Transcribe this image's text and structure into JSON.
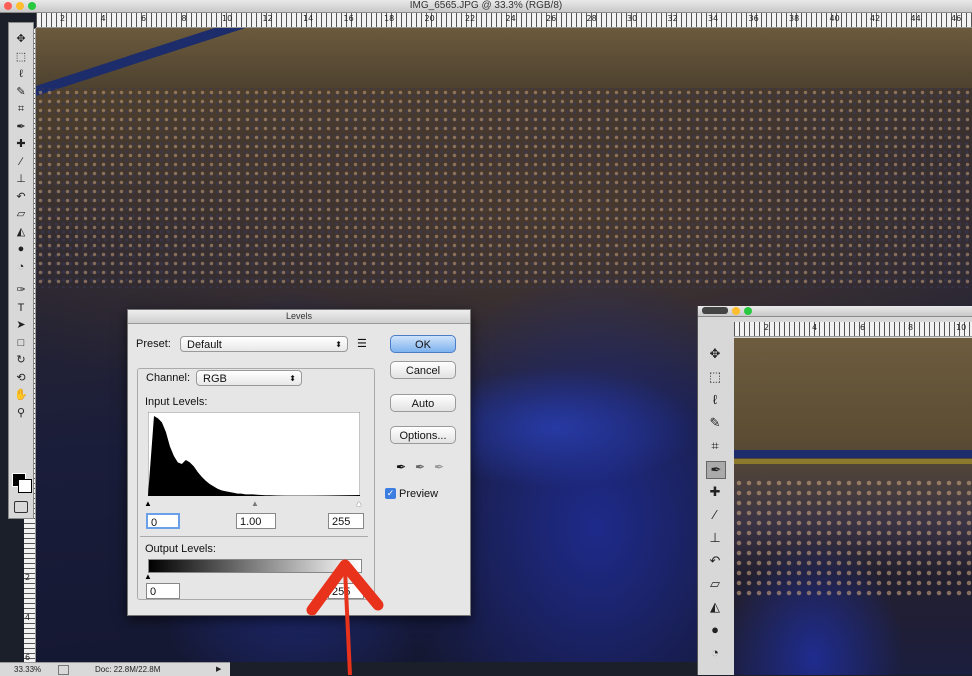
{
  "window": {
    "title": "IMG_6565.JPG @ 33.3% (RGB/8)"
  },
  "ruler_numbers": [
    "2",
    "4",
    "6",
    "8",
    "10",
    "12",
    "14",
    "16",
    "18",
    "20",
    "22",
    "24",
    "26",
    "28",
    "30",
    "32",
    "34",
    "36",
    "38",
    "40",
    "42",
    "44",
    "46"
  ],
  "left_ruler_numbers": [
    "2",
    "4",
    "6"
  ],
  "toolbox_icons": [
    "move-icon",
    "marquee-icon",
    "lasso-icon",
    "quick-select-icon",
    "crop-icon",
    "eyedropper-icon",
    "healing-brush-icon",
    "brush-icon",
    "clone-stamp-icon",
    "history-brush-icon",
    "eraser-icon",
    "paint-bucket-icon",
    "blur-icon",
    "dodge-icon",
    "pen-icon",
    "type-icon",
    "path-select-icon",
    "shape-icon",
    "3d-rotate-icon",
    "3d-orbit-icon",
    "hand-icon",
    "zoom-icon"
  ],
  "status": {
    "zoom": "33.33%",
    "doc": "Doc: 22.8M/22.8M"
  },
  "levels": {
    "title": "Levels",
    "preset_label": "Preset:",
    "preset_value": "Default",
    "channel_label": "Channel:",
    "channel_value": "RGB",
    "input_levels_label": "Input Levels:",
    "input_black": "0",
    "input_gamma": "1.00",
    "input_white": "255",
    "output_levels_label": "Output Levels:",
    "output_black": "0",
    "output_white": "255",
    "ok_label": "OK",
    "cancel_label": "Cancel",
    "auto_label": "Auto",
    "options_label": "Options...",
    "preview_label": "Preview",
    "preview_checked": true
  },
  "histogram": [
    1.0,
    0.97,
    0.92,
    0.8,
    0.62,
    0.5,
    0.42,
    0.4,
    0.45,
    0.42,
    0.37,
    0.3,
    0.24,
    0.19,
    0.15,
    0.12,
    0.09,
    0.07,
    0.06,
    0.05,
    0.04,
    0.03,
    0.03,
    0.02,
    0.02,
    0.02,
    0.015,
    0.012,
    0.01,
    0.01,
    0.008,
    0.006,
    0.005,
    0.004,
    0.004,
    0.003,
    0.003,
    0.002,
    0.002,
    0.002
  ],
  "second_window": {
    "ruler_numbers": [
      "2",
      "4",
      "6",
      "8",
      "10"
    ],
    "tool_icons": [
      "move-icon",
      "marquee-icon",
      "lasso-icon",
      "quick-select-icon",
      "crop-icon",
      "eyedropper-icon",
      "healing-brush-icon",
      "brush-icon",
      "clone-stamp-icon",
      "history-brush-icon",
      "eraser-icon",
      "paint-bucket-icon",
      "blur-icon",
      "dodge-icon"
    ]
  },
  "colors": {
    "annotation_arrow": "#e8321c",
    "ok_button": "#7eb2ee"
  }
}
